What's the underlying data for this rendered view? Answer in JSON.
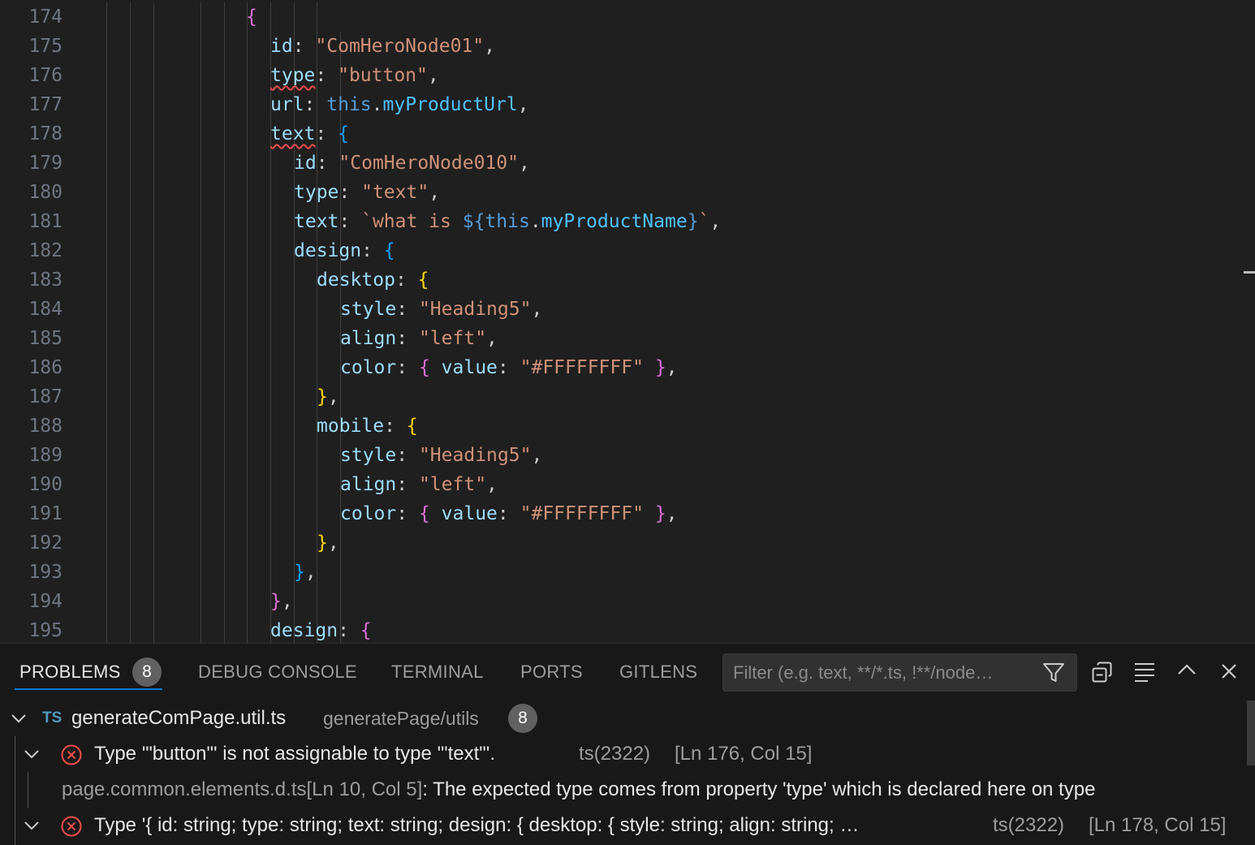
{
  "editor": {
    "lines": [
      {
        "n": "174",
        "indent": 10,
        "tokens": [
          {
            "t": "{",
            "c": "b2"
          }
        ]
      },
      {
        "n": "175",
        "indent": 11,
        "tokens": [
          {
            "t": "id",
            "c": "key"
          },
          {
            "t": ": ",
            "c": "punc"
          },
          {
            "t": "\"ComHeroNode01\"",
            "c": "str"
          },
          {
            "t": ",",
            "c": "punc"
          }
        ]
      },
      {
        "n": "176",
        "indent": 11,
        "tokens": [
          {
            "t": "type",
            "c": "key",
            "err": true
          },
          {
            "t": ": ",
            "c": "punc"
          },
          {
            "t": "\"button\"",
            "c": "str"
          },
          {
            "t": ",",
            "c": "punc"
          }
        ]
      },
      {
        "n": "177",
        "indent": 11,
        "tokens": [
          {
            "t": "url",
            "c": "key"
          },
          {
            "t": ": ",
            "c": "punc"
          },
          {
            "t": "this",
            "c": "kw"
          },
          {
            "t": ".",
            "c": "punc"
          },
          {
            "t": "myProductUrl",
            "c": "prop"
          },
          {
            "t": ",",
            "c": "punc"
          }
        ]
      },
      {
        "n": "178",
        "indent": 11,
        "tokens": [
          {
            "t": "text",
            "c": "key",
            "err": true
          },
          {
            "t": ": ",
            "c": "punc"
          },
          {
            "t": "{",
            "c": "b3"
          }
        ]
      },
      {
        "n": "179",
        "indent": 12,
        "tokens": [
          {
            "t": "id",
            "c": "key"
          },
          {
            "t": ": ",
            "c": "punc"
          },
          {
            "t": "\"ComHeroNode010\"",
            "c": "str"
          },
          {
            "t": ",",
            "c": "punc"
          }
        ]
      },
      {
        "n": "180",
        "indent": 12,
        "tokens": [
          {
            "t": "type",
            "c": "key"
          },
          {
            "t": ": ",
            "c": "punc"
          },
          {
            "t": "\"text\"",
            "c": "str"
          },
          {
            "t": ",",
            "c": "punc"
          }
        ]
      },
      {
        "n": "181",
        "indent": 12,
        "tokens": [
          {
            "t": "text",
            "c": "key"
          },
          {
            "t": ": ",
            "c": "punc"
          },
          {
            "t": "`what is ",
            "c": "str"
          },
          {
            "t": "${",
            "c": "kw"
          },
          {
            "t": "this",
            "c": "kw"
          },
          {
            "t": ".",
            "c": "punc"
          },
          {
            "t": "myProductName",
            "c": "prop"
          },
          {
            "t": "}",
            "c": "kw"
          },
          {
            "t": "`",
            "c": "str"
          },
          {
            "t": ",",
            "c": "punc"
          }
        ]
      },
      {
        "n": "182",
        "indent": 12,
        "tokens": [
          {
            "t": "design",
            "c": "key"
          },
          {
            "t": ": ",
            "c": "punc"
          },
          {
            "t": "{",
            "c": "b3"
          }
        ]
      },
      {
        "n": "183",
        "indent": 13,
        "tokens": [
          {
            "t": "desktop",
            "c": "key"
          },
          {
            "t": ": ",
            "c": "punc"
          },
          {
            "t": "{",
            "c": "b1"
          }
        ]
      },
      {
        "n": "184",
        "indent": 14,
        "tokens": [
          {
            "t": "style",
            "c": "key"
          },
          {
            "t": ": ",
            "c": "punc"
          },
          {
            "t": "\"Heading5\"",
            "c": "str"
          },
          {
            "t": ",",
            "c": "punc"
          }
        ]
      },
      {
        "n": "185",
        "indent": 14,
        "tokens": [
          {
            "t": "align",
            "c": "key"
          },
          {
            "t": ": ",
            "c": "punc"
          },
          {
            "t": "\"left\"",
            "c": "str"
          },
          {
            "t": ",",
            "c": "punc"
          }
        ]
      },
      {
        "n": "186",
        "indent": 14,
        "tokens": [
          {
            "t": "color",
            "c": "key"
          },
          {
            "t": ": ",
            "c": "punc"
          },
          {
            "t": "{",
            "c": "b2"
          },
          {
            "t": " ",
            "c": "punc"
          },
          {
            "t": "value",
            "c": "key"
          },
          {
            "t": ": ",
            "c": "punc"
          },
          {
            "t": "\"#FFFFFFFF\"",
            "c": "str"
          },
          {
            "t": " ",
            "c": "punc"
          },
          {
            "t": "}",
            "c": "b2"
          },
          {
            "t": ",",
            "c": "punc"
          }
        ]
      },
      {
        "n": "187",
        "indent": 13,
        "tokens": [
          {
            "t": "}",
            "c": "b1"
          },
          {
            "t": ",",
            "c": "punc"
          }
        ]
      },
      {
        "n": "188",
        "indent": 13,
        "tokens": [
          {
            "t": "mobile",
            "c": "key"
          },
          {
            "t": ": ",
            "c": "punc"
          },
          {
            "t": "{",
            "c": "b1"
          }
        ]
      },
      {
        "n": "189",
        "indent": 14,
        "tokens": [
          {
            "t": "style",
            "c": "key"
          },
          {
            "t": ": ",
            "c": "punc"
          },
          {
            "t": "\"Heading5\"",
            "c": "str"
          },
          {
            "t": ",",
            "c": "punc"
          }
        ]
      },
      {
        "n": "190",
        "indent": 14,
        "tokens": [
          {
            "t": "align",
            "c": "key"
          },
          {
            "t": ": ",
            "c": "punc"
          },
          {
            "t": "\"left\"",
            "c": "str"
          },
          {
            "t": ",",
            "c": "punc"
          }
        ]
      },
      {
        "n": "191",
        "indent": 14,
        "tokens": [
          {
            "t": "color",
            "c": "key"
          },
          {
            "t": ": ",
            "c": "punc"
          },
          {
            "t": "{",
            "c": "b2"
          },
          {
            "t": " ",
            "c": "punc"
          },
          {
            "t": "value",
            "c": "key"
          },
          {
            "t": ": ",
            "c": "punc"
          },
          {
            "t": "\"#FFFFFFFF\"",
            "c": "str"
          },
          {
            "t": " ",
            "c": "punc"
          },
          {
            "t": "}",
            "c": "b2"
          },
          {
            "t": ",",
            "c": "punc"
          }
        ]
      },
      {
        "n": "192",
        "indent": 13,
        "tokens": [
          {
            "t": "}",
            "c": "b1"
          },
          {
            "t": ",",
            "c": "punc"
          }
        ]
      },
      {
        "n": "193",
        "indent": 12,
        "tokens": [
          {
            "t": "}",
            "c": "b3"
          },
          {
            "t": ",",
            "c": "punc"
          }
        ]
      },
      {
        "n": "194",
        "indent": 11,
        "tokens": [
          {
            "t": "}",
            "c": "b2"
          },
          {
            "t": ",",
            "c": "punc"
          }
        ]
      },
      {
        "n": "195",
        "indent": 11,
        "tokens": [
          {
            "t": "design",
            "c": "key"
          },
          {
            "t": ": ",
            "c": "punc"
          },
          {
            "t": "{",
            "c": "b2"
          }
        ]
      }
    ]
  },
  "panel": {
    "tabs": [
      {
        "label": "PROBLEMS",
        "badge": "8",
        "active": true
      },
      {
        "label": "DEBUG CONSOLE"
      },
      {
        "label": "TERMINAL"
      },
      {
        "label": "PORTS"
      },
      {
        "label": "GITLENS"
      }
    ],
    "filter_placeholder": "Filter (e.g. text, **/*.ts, !**/node…",
    "actions": [
      "filter-icon",
      "collapse-all-icon",
      "word-wrap-icon",
      "maximize-panel-icon",
      "close-panel-icon"
    ],
    "file": {
      "lang": "TS",
      "name": "generateComPage.util.ts",
      "path": "generatePage/utils",
      "count": "8"
    },
    "problems": [
      {
        "message": "Type '\"button\"' is not assignable to type '\"text\"'.",
        "code": "ts(2322)",
        "location": "[Ln 176, Col 15]",
        "related": {
          "file": "page.common.elements.d.ts",
          "location": "[Ln 10, Col 5]",
          "message": ": The expected type comes from property 'type' which is declared here on type"
        }
      },
      {
        "message": "Type '{ id: string; type: string; text: string; design: { desktop: { style: string; align: string; …",
        "code": "ts(2322)",
        "location": "[Ln 178, Col 15]"
      }
    ]
  },
  "colors": {
    "editor_bg": "#1f1f1f",
    "panel_bg": "#181818",
    "error": "#f14c4c",
    "accent": "#0078d4"
  }
}
